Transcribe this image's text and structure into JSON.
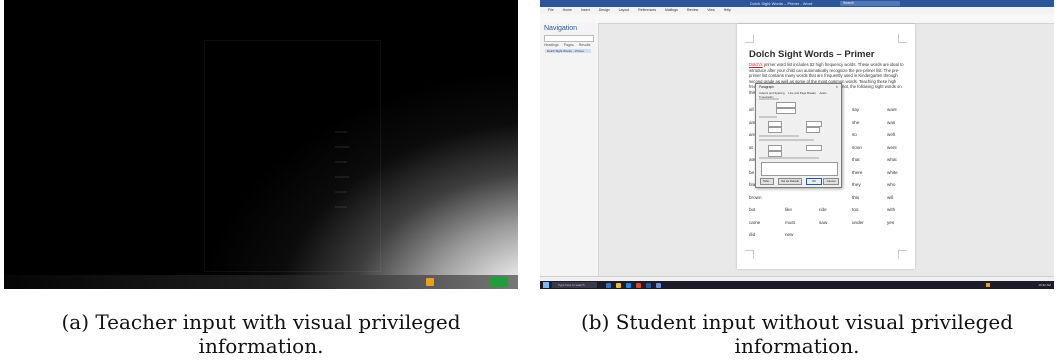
{
  "captions": {
    "a": "(a) Teacher input with visual privileged information.",
    "b_line1": "(b) Student input without visual privileged",
    "b_line2": "information."
  },
  "student_screen": {
    "title_bar": {
      "title": "Dolch Sight Words – Primer - Word",
      "search": "Search"
    },
    "menu": [
      "File",
      "Home",
      "Insert",
      "Design",
      "Layout",
      "References",
      "Mailings",
      "Review",
      "View",
      "Help"
    ],
    "navigation": {
      "title": "Navigation",
      "tabs": [
        "Headings",
        "Pages",
        "Results"
      ],
      "item": "Dolch Sight Words – Primer"
    },
    "document": {
      "heading": "Dolch Sight Words – Primer",
      "paragraph_underlined": "Dolch's",
      "paragraph": " primer word list includes 52 high frequency words. These words are ideal to introduce after your child can automatically recognize the pre-primer list. The pre-primer list contains many words that are frequently used in Kindergarten through second grade as well as some of the most common words. Teaching these high frequency words, some are decodable and others not, the following sight words on this primer list.",
      "words": [
        [
          "all",
          "",
          "",
          "say",
          "want"
        ],
        [
          "am",
          "",
          "",
          "she",
          "was"
        ],
        [
          "are",
          "",
          "",
          "so",
          "well"
        ],
        [
          "at",
          "",
          "",
          "soon",
          "went"
        ],
        [
          "ate",
          "",
          "",
          "that",
          "what"
        ],
        [
          "be",
          "",
          "",
          "there",
          "white"
        ],
        [
          "black",
          "",
          "",
          "they",
          "who"
        ],
        [
          "brown",
          "",
          "",
          "this",
          "will"
        ],
        [
          "but",
          "like",
          "ride",
          "too",
          "with"
        ],
        [
          "came",
          "must",
          "saw",
          "under",
          "yes"
        ],
        [
          "did",
          "new",
          "",
          "",
          ""
        ]
      ]
    },
    "dialog": {
      "title": "Paragraph",
      "close": "×",
      "tabs": [
        "Indents and Spacing",
        "Line and Page Breaks",
        "Asian Typography"
      ],
      "buttons": [
        "Tabs...",
        "Set As Default",
        "OK",
        "Cancel"
      ]
    },
    "taskbar": {
      "search_placeholder": "Type here to search",
      "clock": "10:32 AM"
    }
  },
  "colors": {
    "word_blue": "#2b579a",
    "warning": "#e8a11a",
    "active_green": "#1f9e3a"
  }
}
